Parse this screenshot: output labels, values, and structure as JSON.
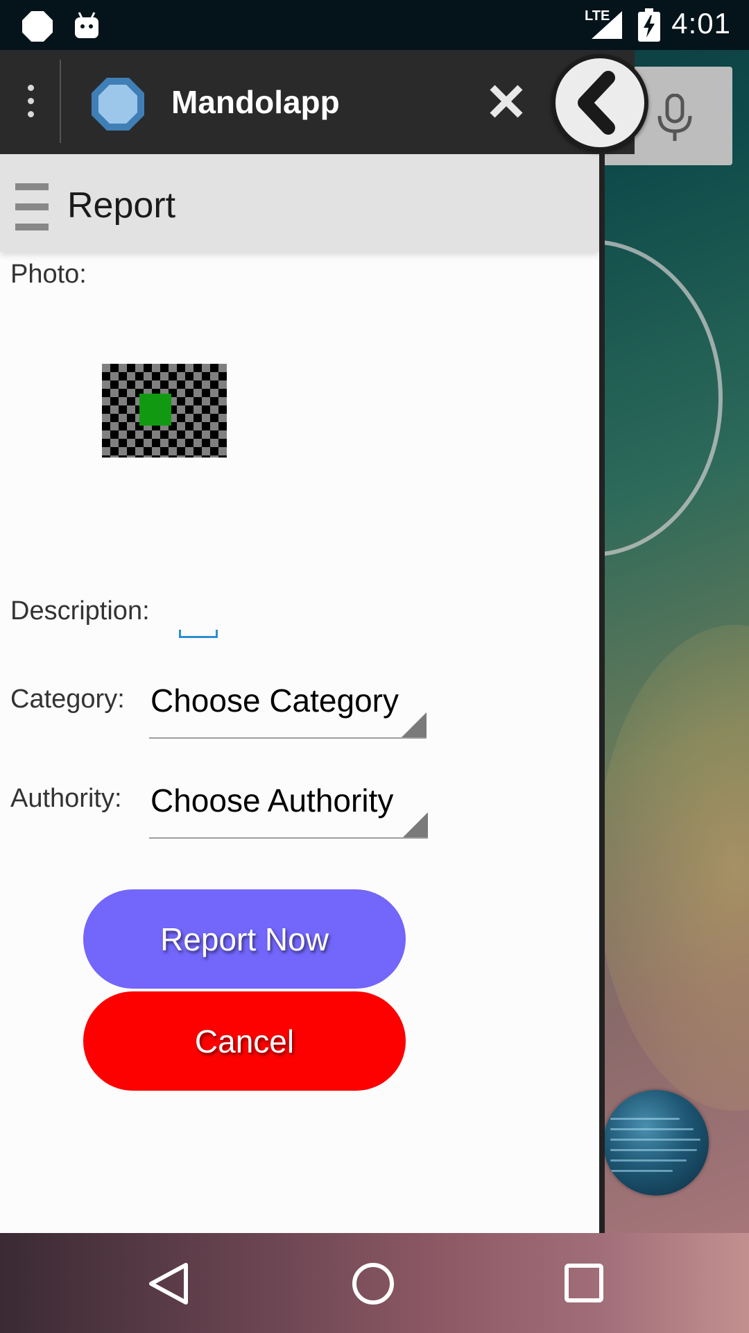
{
  "status_bar": {
    "time": "4:01",
    "network": "LTE"
  },
  "app_header": {
    "title": "Mandolapp"
  },
  "toolbar": {
    "title": "Report"
  },
  "form": {
    "photo_label": "Photo:",
    "description_label": "Description:",
    "category_label": "Category:",
    "category_value": "Choose Category",
    "authority_label": "Authority:",
    "authority_value": "Choose Authority"
  },
  "buttons": {
    "report_now": "Report Now",
    "cancel": "Cancel"
  },
  "colors": {
    "report_button": "#7266fb",
    "cancel_button": "#fd0000",
    "photo_accent": "#119a11",
    "input_focus": "#2b8fd0"
  },
  "icons": {
    "status_left": [
      "octagon-icon",
      "android-debug-icon"
    ],
    "status_right": [
      "signal-icon",
      "battery-charging-icon"
    ],
    "header": [
      "overflow-menu-icon",
      "app-logo-icon",
      "close-icon",
      "back-arrow-icon"
    ],
    "toolbar": [
      "hamburger-menu-icon"
    ],
    "launcher": [
      "microphone-icon"
    ],
    "nav": [
      "nav-back-icon",
      "nav-home-icon",
      "nav-recents-icon"
    ]
  }
}
